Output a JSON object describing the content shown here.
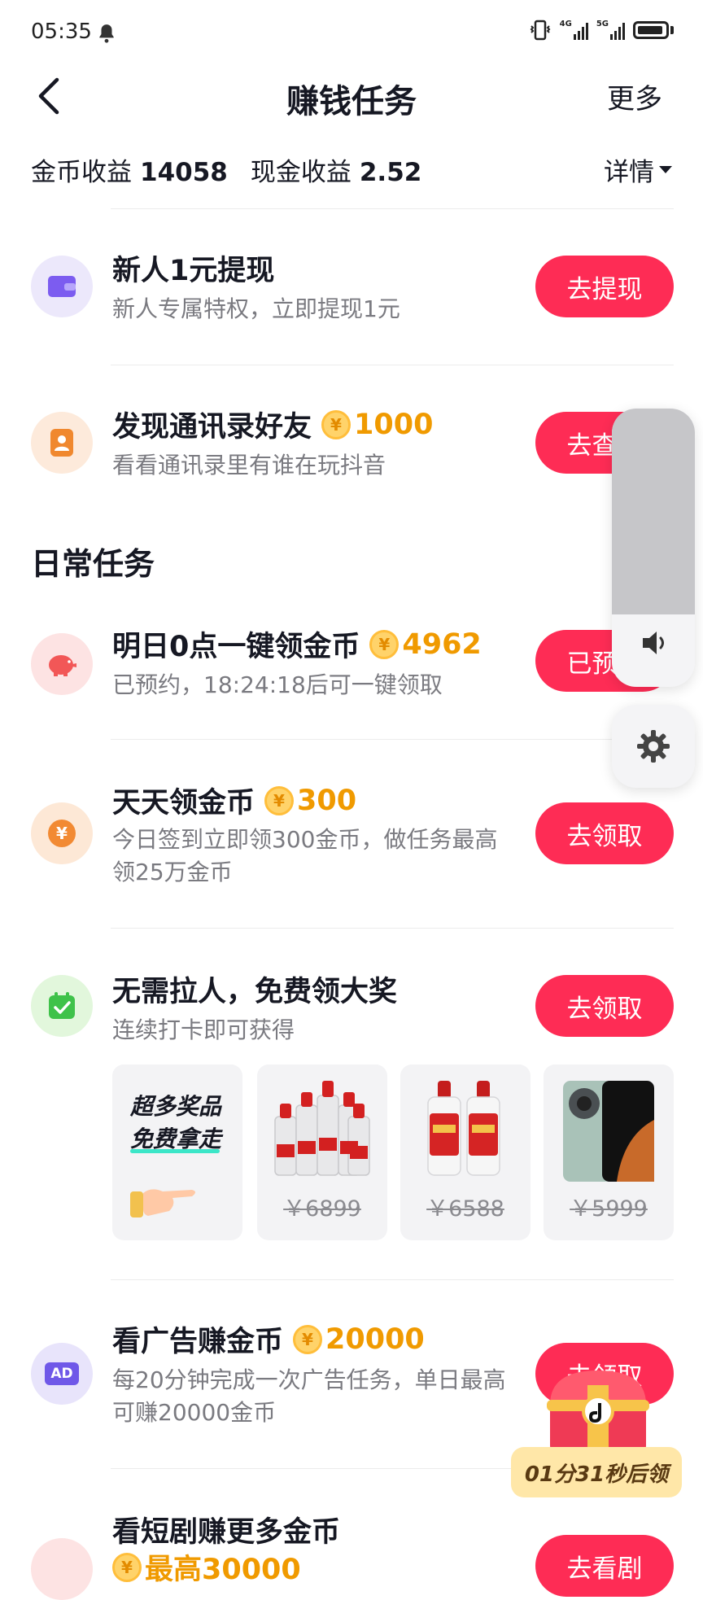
{
  "status_bar": {
    "time": "05:35",
    "net1": "4G",
    "net2": "5G"
  },
  "header": {
    "title": "赚钱任务",
    "more": "更多"
  },
  "earnings": {
    "gold_label": "金币收益",
    "gold_value": "14058",
    "cash_label": "现金收益",
    "cash_value": "2.52",
    "detail": "详情"
  },
  "tasks_top": [
    {
      "title": "新人1元提现",
      "desc": "新人专属特权，立即提现1元",
      "button": "去提现"
    },
    {
      "title": "发现通讯录好友",
      "reward": "1000",
      "desc": "看看通讯录里有谁在玩抖音",
      "button": "去查看"
    }
  ],
  "section_title": "日常任务",
  "daily_tasks": [
    {
      "title": "明日0点一键领金币",
      "reward": "4962",
      "desc": "已预约，18:24:18后可一键领取",
      "button": "已预约"
    },
    {
      "title": "天天领金币",
      "reward": "300",
      "desc": "今日签到立即领300金币，做任务最高领25万金币",
      "button": "去领取"
    },
    {
      "title": "无需拉人，免费领大奖",
      "desc": "连续打卡即可获得",
      "button": "去领取"
    },
    {
      "title": "看广告赚金币",
      "reward": "20000",
      "desc": "每20分钟完成一次广告任务，单日最高可赚20000金币",
      "button": "去领取"
    },
    {
      "title": "看短剧赚更多金币",
      "reward": "最高30000",
      "button": "去看剧"
    }
  ],
  "prize_cards": {
    "promo_line1": "超多奖品",
    "promo_line2": "免费拿走",
    "prices": [
      "￥6899",
      "￥6588",
      "￥5999"
    ]
  },
  "ad_badge": "AD",
  "coin_symbol": "¥",
  "treasure_timer": "01分31秒后领",
  "volume_level": 0.26,
  "colors": {
    "primary_button": "#fe2c55",
    "reward": "#f09a00",
    "muted_text": "#7a7a80"
  }
}
